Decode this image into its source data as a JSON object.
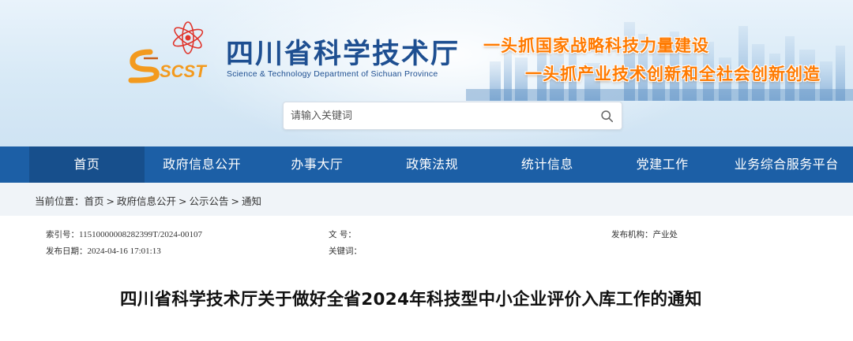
{
  "header": {
    "logo_text": "SCST",
    "site_title": "四川省科学技术厅",
    "site_subtitle": "Science & Technology Department of Sichuan Province",
    "slogan_1": "一头抓国家战略科技力量建设",
    "slogan_2": "一头抓产业技术创新和全社会创新创造",
    "colors": {
      "title": "#1e4f91",
      "slogan": "#ff7a00",
      "header_bg": "#d7e9f6"
    }
  },
  "search": {
    "placeholder": "请输入关键词",
    "icon": "search-icon"
  },
  "nav": {
    "items": [
      {
        "label": "首页",
        "active": true
      },
      {
        "label": "政府信息公开"
      },
      {
        "label": "办事大厅"
      },
      {
        "label": "政策法规"
      },
      {
        "label": "统计信息"
      },
      {
        "label": "党建工作"
      },
      {
        "label": "业务综合服务平台"
      }
    ],
    "colors": {
      "bg": "#1c5fa6",
      "active_bg": "#174f8c"
    }
  },
  "breadcrumb": {
    "prefix": "当前位置：",
    "items": [
      "首页",
      "政府信息公开",
      "公示公告",
      "通知"
    ],
    "separator": ">"
  },
  "meta": {
    "index_label": "索引号：",
    "index_value": "11510000008282399T/2024-00107",
    "docno_label": "文 号：",
    "docno_value": "",
    "publisher_label": "发布机构：",
    "publisher_value": "产业处",
    "date_label": "发布日期：",
    "date_value": "2024-04-16 17:01:13",
    "keywords_label": "关键词：",
    "keywords_value": ""
  },
  "article": {
    "title": "四川省科学技术厅关于做好全省2024年科技型中小企业评价入库工作的通知"
  }
}
